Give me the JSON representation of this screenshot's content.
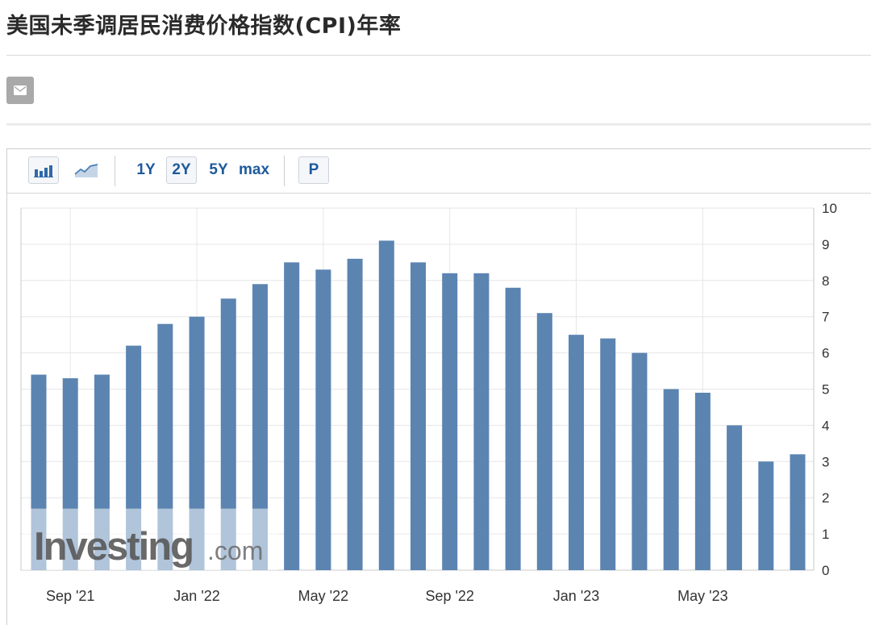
{
  "page": {
    "title": "美国未季调居民消费价格指数(CPI)年率"
  },
  "toolbar": {
    "bar_chart_icon": "bar-chart-icon",
    "line_chart_icon": "line-chart-icon",
    "range_1y": "1Y",
    "range_2y": "2Y",
    "range_5y": "5Y",
    "range_max": "max",
    "p_label": "P",
    "selected_range": "2Y"
  },
  "share": {
    "icon": "mail-icon"
  },
  "watermark": {
    "main": "Investing",
    "suffix": ".com"
  },
  "colors": {
    "bar": "#5b84b1",
    "grid": "#e6e6e6",
    "axis": "#c8c8c8",
    "text": "#333333"
  },
  "chart_data": {
    "type": "bar",
    "categories": [
      "Aug '21",
      "Sep '21",
      "Oct '21",
      "Nov '21",
      "Dec '21",
      "Jan '22",
      "Feb '22",
      "Mar '22",
      "Apr '22",
      "May '22",
      "Jun '22",
      "Jul '22",
      "Aug '22",
      "Sep '22",
      "Oct '22",
      "Nov '22",
      "Dec '22",
      "Jan '23",
      "Feb '23",
      "Mar '23",
      "Apr '23",
      "May '23",
      "Jun '23",
      "Jul '23"
    ],
    "values": [
      5.4,
      5.3,
      5.4,
      6.2,
      6.8,
      7.0,
      7.5,
      7.9,
      8.5,
      8.3,
      8.6,
      9.1,
      8.5,
      8.2,
      8.2,
      7.8,
      7.1,
      6.5,
      6.4,
      6.0,
      5.0,
      4.9,
      4.0,
      3.0,
      3.2
    ],
    "x_tick_labels": [
      "Sep '21",
      "Jan '22",
      "May '22",
      "Sep '22",
      "Jan '23",
      "May '23"
    ],
    "y_ticks": [
      0,
      1,
      2,
      3,
      4,
      5,
      6,
      7,
      8,
      9,
      10
    ],
    "ylim": [
      0,
      10
    ],
    "y_axis_side": "right",
    "grid": true,
    "legend": "none"
  }
}
